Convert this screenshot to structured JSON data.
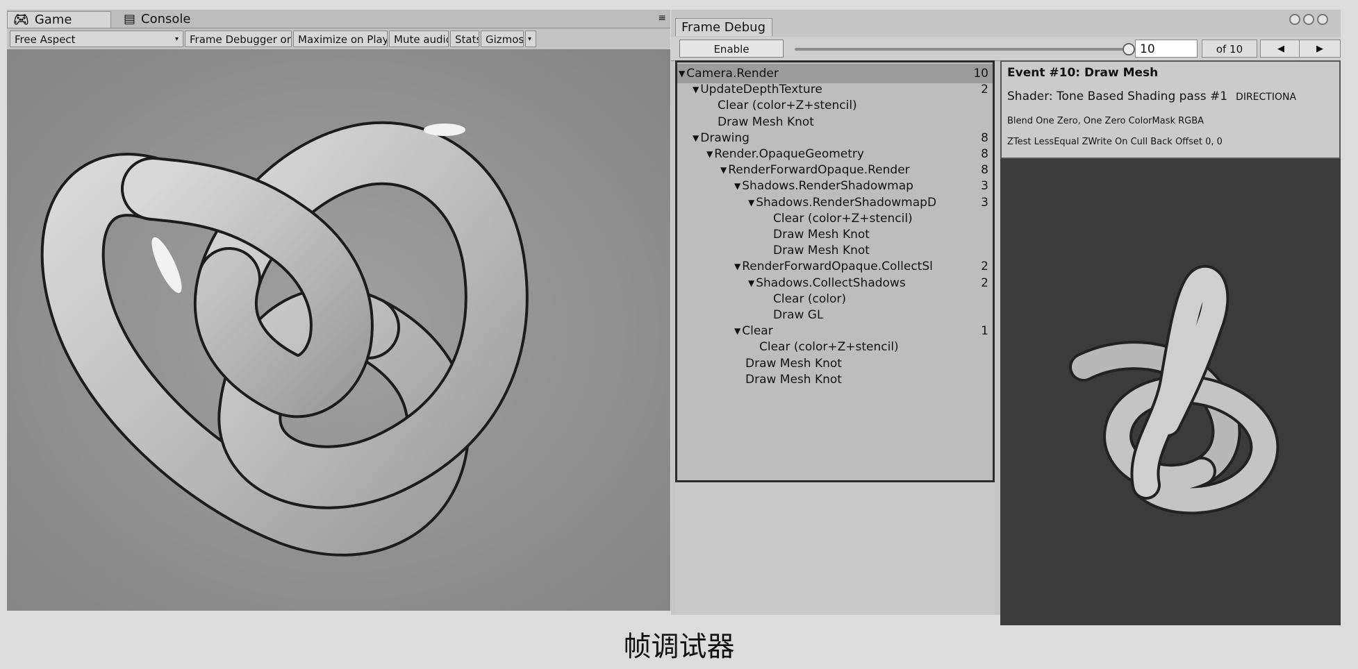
{
  "game_window": {
    "tabs": [
      {
        "icon": "game-icon",
        "label": "Game"
      },
      {
        "icon": "console-icon",
        "label": "Console"
      }
    ],
    "toolbar": {
      "aspect": "Free Aspect",
      "frame_debugger": "Frame Debugger on",
      "maximize": "Maximize on Play",
      "mute": "Mute audio",
      "stats": "Stats",
      "gizmos": "Gizmos"
    }
  },
  "frame_debug": {
    "title": "Frame Debug",
    "enable": "Enable",
    "slider_position": 1.0,
    "current_event": "10",
    "of_total": "of 10",
    "prev_icon": "triangle-left-icon",
    "next_icon": "triangle-right-icon",
    "tree": [
      {
        "label": "Camera.Render",
        "count": "10",
        "expanded": true
      },
      {
        "label": "UpdateDepthTexture",
        "count": "2",
        "expanded": true
      },
      {
        "label": "Clear (color+Z+stencil)",
        "count": ""
      },
      {
        "label": "Draw Mesh Knot",
        "count": ""
      },
      {
        "label": "Drawing",
        "count": "8",
        "expanded": true
      },
      {
        "label": "Render.OpaqueGeometry",
        "count": "8",
        "expanded": true
      },
      {
        "label": "RenderForwardOpaque.Render",
        "count": "8",
        "expanded": true
      },
      {
        "label": "Shadows.RenderShadowmap",
        "count": "3",
        "expanded": true
      },
      {
        "label": "Shadows.RenderShadowmapD",
        "count": "3",
        "expanded": true
      },
      {
        "label": "Clear (color+Z+stencil)",
        "count": ""
      },
      {
        "label": "Draw Mesh Knot",
        "count": ""
      },
      {
        "label": "Draw Mesh Knot",
        "count": ""
      },
      {
        "label": "RenderForwardOpaque.CollectSl",
        "count": "2",
        "expanded": true
      },
      {
        "label": "Shadows.CollectShadows",
        "count": "2",
        "expanded": true
      },
      {
        "label": "Clear (color)",
        "count": ""
      },
      {
        "label": "Draw GL",
        "count": ""
      },
      {
        "label": "Clear",
        "count": "1",
        "expanded": true
      },
      {
        "label": "Clear (color+Z+stencil)",
        "count": ""
      },
      {
        "label": "Draw Mesh Knot",
        "count": ""
      },
      {
        "label": "Draw Mesh Knot",
        "count": ""
      }
    ],
    "event": {
      "title": "Event #10: Draw Mesh",
      "shader": "Shader: Tone Based Shading pass #1",
      "keyword": "DIRECTIONA",
      "blend": "Blend One Zero, One Zero ColorMask RGBA",
      "ztest": "ZTest LessEqual ZWrite On Cull Back Offset 0, 0"
    }
  },
  "caption": "帧调试器"
}
